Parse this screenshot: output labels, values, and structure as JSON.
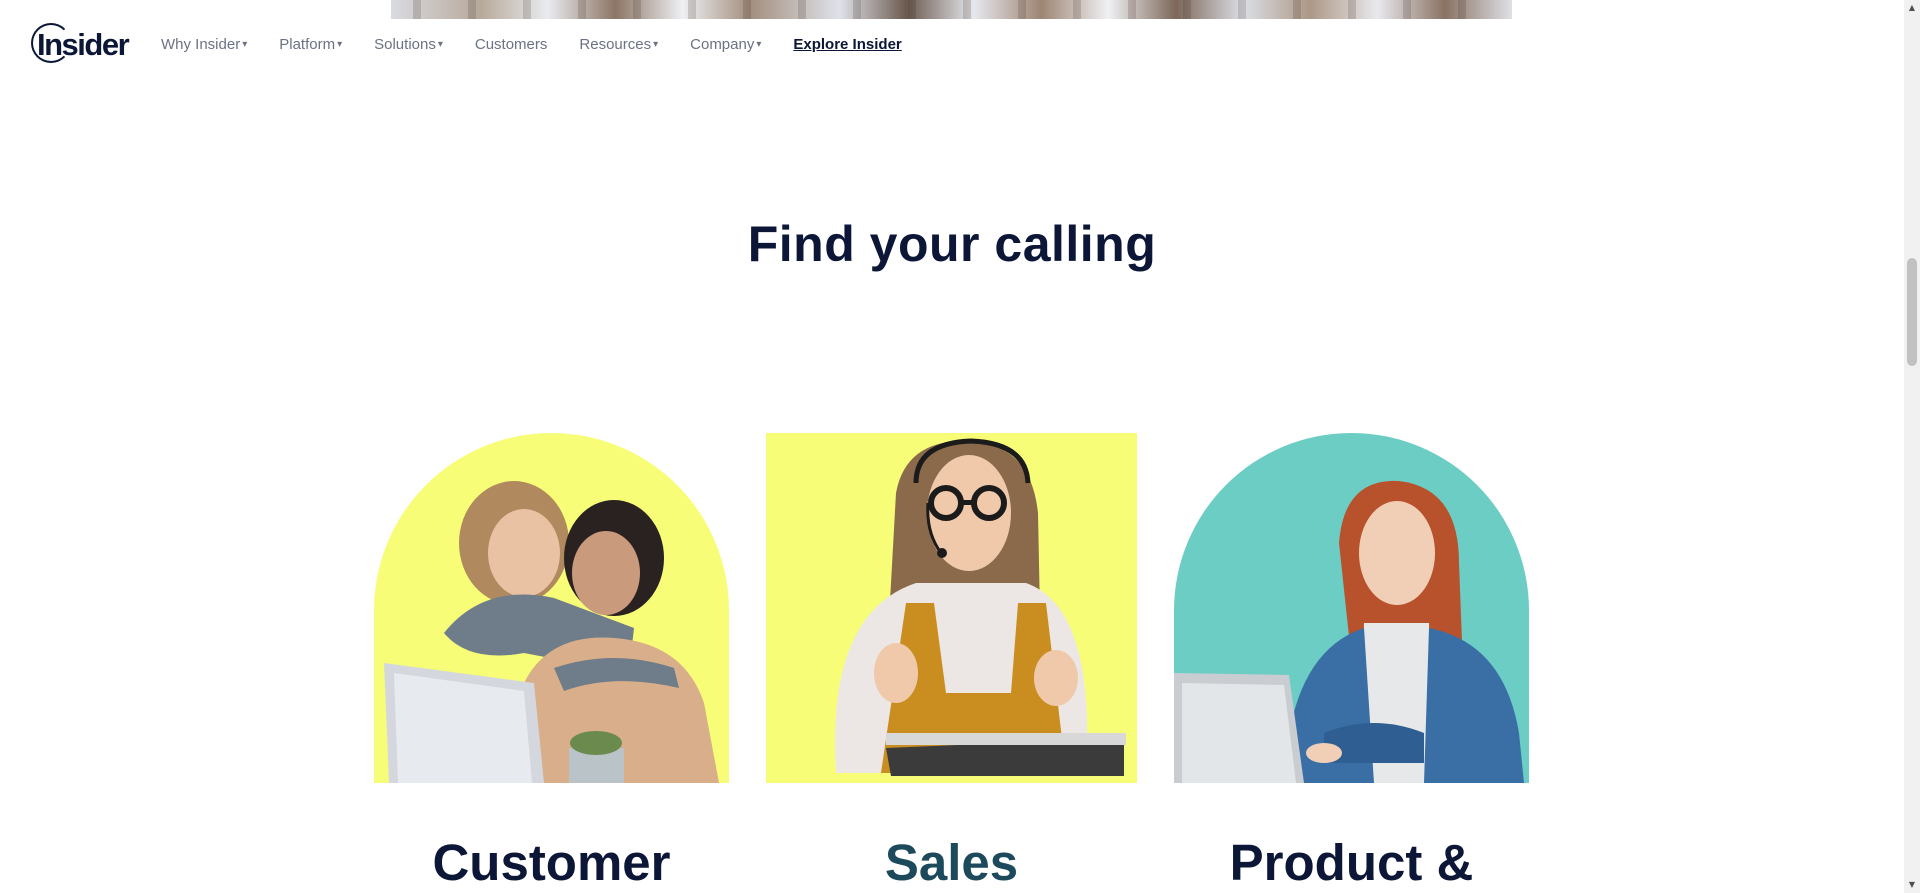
{
  "header": {
    "logo_text": "Insider",
    "nav": [
      {
        "label": "Why Insider",
        "has_dropdown": true
      },
      {
        "label": "Platform",
        "has_dropdown": true
      },
      {
        "label": "Solutions",
        "has_dropdown": true
      },
      {
        "label": "Customers",
        "has_dropdown": false
      },
      {
        "label": "Resources",
        "has_dropdown": true
      },
      {
        "label": "Company",
        "has_dropdown": true
      },
      {
        "label": "Explore Insider",
        "has_dropdown": false
      }
    ],
    "caret_glyph": "▾"
  },
  "main": {
    "heading": "Find your calling",
    "cards": [
      {
        "title": "Customer",
        "icon": "team-photo-icon",
        "bg_color": "#f7fd77"
      },
      {
        "title": "Sales",
        "icon": "sales-photo-icon",
        "bg_color": "#f7fd77"
      },
      {
        "title": "Product &",
        "icon": "product-photo-icon",
        "bg_color": "#6ccdc4"
      }
    ]
  },
  "scrollbar": {
    "up_glyph": "▲",
    "down_glyph": "▼"
  },
  "colors": {
    "navy": "#0c1636",
    "nav_gray": "#6c7285",
    "yellow": "#f7fd77",
    "teal": "#6ccdc4",
    "sales_title": "#1c4a5c"
  }
}
